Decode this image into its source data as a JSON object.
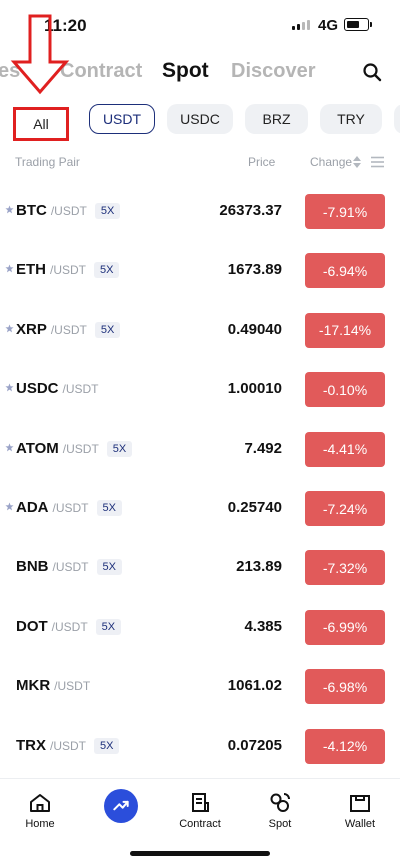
{
  "status_bar": {
    "time": "11:20",
    "network": "4G"
  },
  "top_tabs": [
    {
      "label": "es"
    },
    {
      "label": "Contract"
    },
    {
      "label": "Spot"
    },
    {
      "label": "Discover"
    }
  ],
  "quote_tabs": [
    {
      "label": "All"
    },
    {
      "label": "USDT"
    },
    {
      "label": "USDC"
    },
    {
      "label": "BRZ"
    },
    {
      "label": "TRY"
    }
  ],
  "columns": {
    "pair": "Trading Pair",
    "price": "Price",
    "change": "Change"
  },
  "rows": [
    {
      "symbol": "BTC",
      "quote": "/USDT",
      "leverage": "5X",
      "price": "26373.37",
      "change": "-7.91%"
    },
    {
      "symbol": "ETH",
      "quote": "/USDT",
      "leverage": "5X",
      "price": "1673.89",
      "change": "-6.94%"
    },
    {
      "symbol": "XRP",
      "quote": "/USDT",
      "leverage": "5X",
      "price": "0.49040",
      "change": "-17.14%"
    },
    {
      "symbol": "USDC",
      "quote": "/USDT",
      "leverage": "",
      "price": "1.00010",
      "change": "-0.10%"
    },
    {
      "symbol": "ATOM",
      "quote": "/USDT",
      "leverage": "5X",
      "price": "7.492",
      "change": "-4.41%"
    },
    {
      "symbol": "ADA",
      "quote": "/USDT",
      "leverage": "5X",
      "price": "0.25740",
      "change": "-7.24%"
    },
    {
      "symbol": "BNB",
      "quote": "/USDT",
      "leverage": "5X",
      "price": "213.89",
      "change": "-7.32%"
    },
    {
      "symbol": "DOT",
      "quote": "/USDT",
      "leverage": "5X",
      "price": "4.385",
      "change": "-6.99%"
    },
    {
      "symbol": "MKR",
      "quote": "/USDT",
      "leverage": "",
      "price": "1061.02",
      "change": "-6.98%"
    },
    {
      "symbol": "TRX",
      "quote": "/USDT",
      "leverage": "5X",
      "price": "0.07205",
      "change": "-4.12%"
    }
  ],
  "tab_bar": [
    {
      "label": "Home",
      "icon": "home-icon"
    },
    {
      "label": "",
      "icon": "trend-icon"
    },
    {
      "label": "Contract",
      "icon": "contract-icon"
    },
    {
      "label": "Spot",
      "icon": "spot-icon"
    },
    {
      "label": "Wallet",
      "icon": "wallet-icon"
    }
  ],
  "colors": {
    "negative": "#e15a5a",
    "accent": "#1d2f7a",
    "annotation": "#e02020",
    "fab": "#2b4edb"
  }
}
